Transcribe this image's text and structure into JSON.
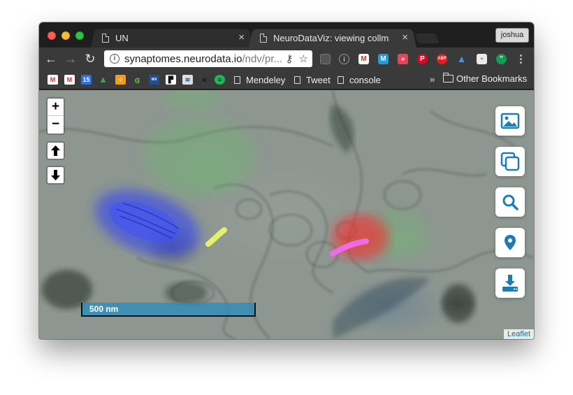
{
  "browser": {
    "tabs": [
      {
        "title": "UN",
        "close": "×"
      },
      {
        "title": "NeuroDataViz: viewing collman",
        "close": "×"
      }
    ],
    "profile_name": "joshua",
    "address": {
      "domain": "synaptomes.neurodata.io",
      "path": "/ndv/pr..."
    },
    "nav": {
      "back": "←",
      "forward": "→",
      "reload": "↻"
    },
    "extensions": [
      "stack-icon",
      "info-icon",
      "gmail-icon",
      "m-icon",
      "pocket-icon",
      "pinterest-icon",
      "adblock-icon",
      "graduate-icon",
      "note-icon",
      "hangouts-icon",
      "menu-icon"
    ]
  },
  "bookmarks": {
    "icons": [
      "gmail",
      "gmail-alt",
      "calendar",
      "drive",
      "grid",
      "jsfiddle",
      "weather",
      "pocket",
      "bookmark-doc",
      "github",
      "spotify"
    ],
    "calendar_day": "15",
    "links": [
      "Mendeley",
      "Tweet",
      "console"
    ],
    "more": "»",
    "folder": "Other Bookmarks"
  },
  "map": {
    "zoom_in": "+",
    "zoom_out": "−",
    "scale_label": "500 nm",
    "attribution": "Leaflet",
    "side_buttons": [
      "image-icon",
      "layers-icon",
      "search-icon",
      "location-pin-icon",
      "download-icon"
    ]
  }
}
